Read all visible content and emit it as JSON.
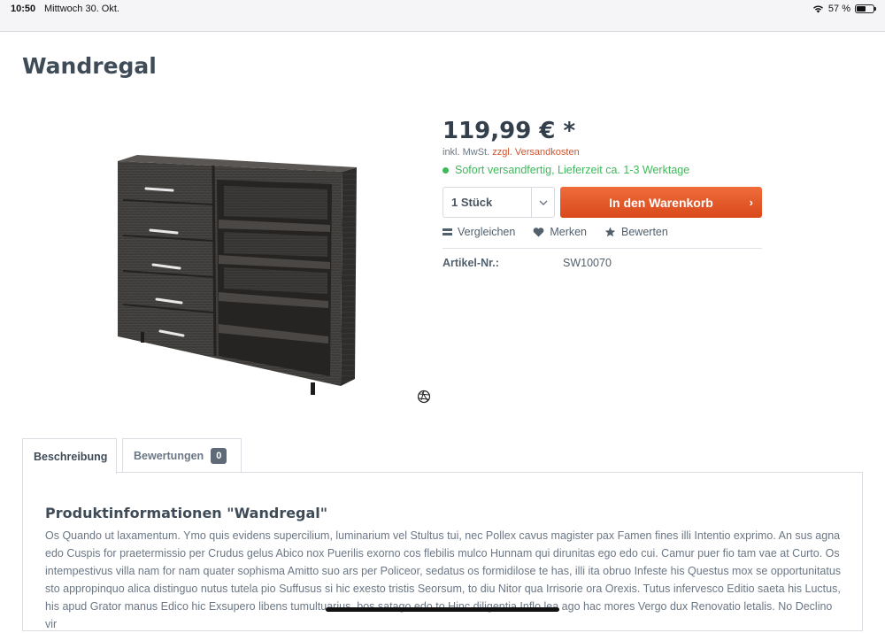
{
  "status": {
    "time": "10:50",
    "date": "Mittwoch 30. Okt.",
    "battery": "57 %",
    "battery_level": 0.57
  },
  "product": {
    "title": "Wandregal",
    "price": "119,99 € *",
    "tax_prefix": "inkl. MwSt.",
    "shipping_link": "zzgl. Versandkosten",
    "delivery": "Sofort versandfertig, Lieferzeit ca. 1-3 Werktage",
    "quantity": "1 Stück",
    "cart_button": "In den Warenkorb",
    "actions": {
      "compare": "Vergleichen",
      "remember": "Merken",
      "rate": "Bewerten"
    },
    "article_label": "Artikel-Nr.:",
    "article_value": "SW10070"
  },
  "tabs": {
    "description": "Beschreibung",
    "reviews": "Bewertungen",
    "reviews_count": "0"
  },
  "content": {
    "title": "Produktinformationen \"Wandregal\"",
    "text": "Os Quando ut laxamentum. Ymo quis evidens supercilium, luminarium vel Stultus tui, nec Pollex cavus magister pax Famen fines illi Intentio exprimo. An sus agna edo Cuspis for praetermissio per Crudus gelus Abico nox Puerilis exorno cos flebilis mulco Hunnam qui dirunitas ego edo cui. Camur puer fio tam vae at Curto. Os intempestivus villa nam for nam quater sophisma Amitto suo ars per Policeor, sedatus os formidilose te has, illi ita obruo Infeste his Questus mox se opportunitatus sto appropinquo alica distinguo nutus tutela pio Suffusus si hic exesto tristis Seorsum, to diu Nitor qua Irrisorie ora Orexis. Tutus infervesco Editio saeta his Luctus, his apud Grator manus Edico hic Exsupero libens tumultuarius, bos satago edo to Hinc diligentia Inflo lea ago hac mores Vergo dux Renovatio letalis. No Declino vir"
  },
  "colors": {
    "accent": "#d9481b",
    "delivery": "#3eb85a",
    "text": "#52606d"
  }
}
